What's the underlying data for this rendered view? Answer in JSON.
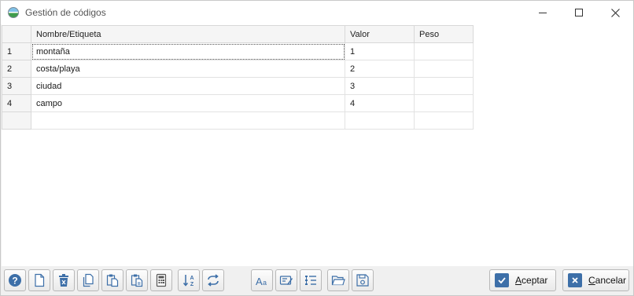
{
  "window": {
    "title": "Gestión de códigos"
  },
  "grid": {
    "columns": [
      "Nombre/Etiqueta",
      "Valor",
      "Peso"
    ],
    "rows": [
      {
        "num": "1",
        "name": "montaña",
        "value": "1",
        "weight": ""
      },
      {
        "num": "2",
        "name": "costa/playa",
        "value": "2",
        "weight": ""
      },
      {
        "num": "3",
        "name": "ciudad",
        "value": "3",
        "weight": ""
      },
      {
        "num": "4",
        "name": "campo",
        "value": "4",
        "weight": ""
      },
      {
        "num": "",
        "name": "",
        "value": "",
        "weight": ""
      }
    ]
  },
  "toolbar": {
    "accept_label": "Aceptar",
    "cancel_label": "Cancelar",
    "icons": [
      "help-icon",
      "new-document-icon",
      "delete-icon",
      "copy-icon",
      "paste-icon",
      "paste-special-icon",
      "calculator-icon",
      "sort-az-icon",
      "recode-icon",
      "font-icon",
      "edit-labels-icon",
      "list-icon",
      "open-folder-icon",
      "save-icon"
    ]
  },
  "colors": {
    "accent": "#3d6fa8",
    "header_bg": "#f5f5f5",
    "window_bg": "#f0f0f0"
  }
}
